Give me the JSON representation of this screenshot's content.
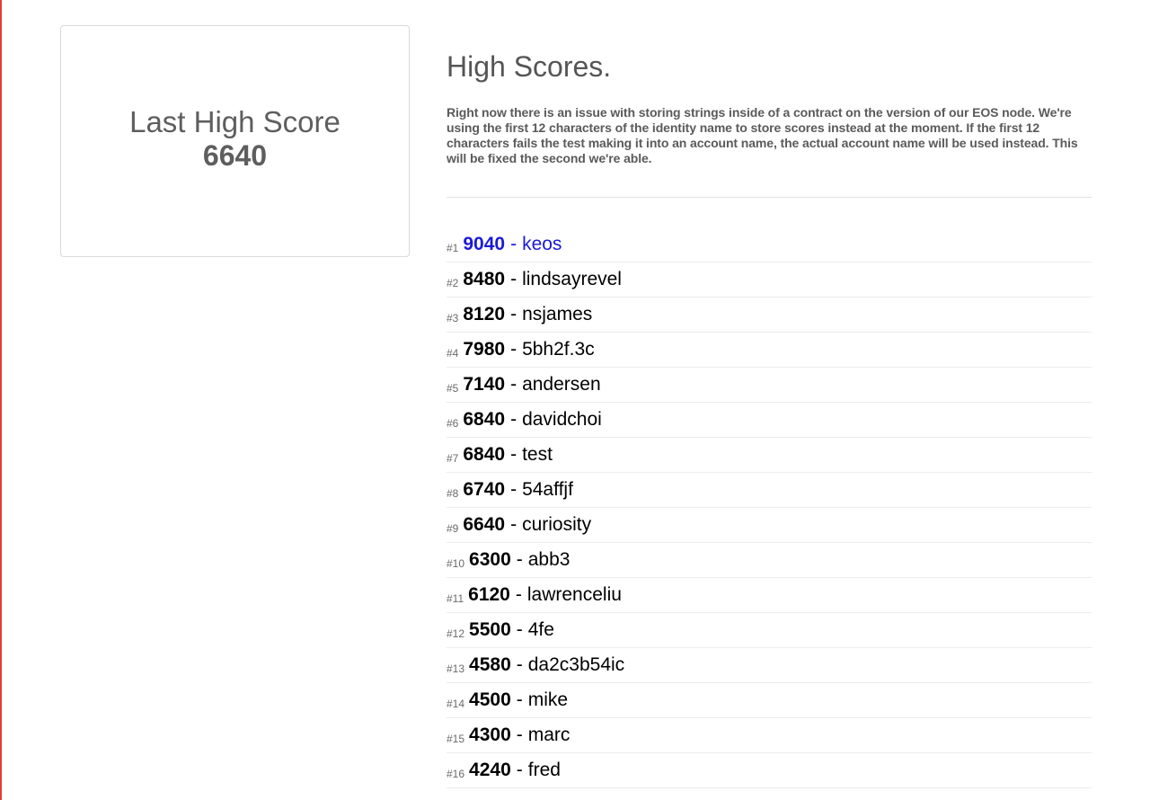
{
  "last_high_score": {
    "label": "Last High Score",
    "value": "6640"
  },
  "main": {
    "title": "High Scores.",
    "notice": "Right now there is an issue with storing strings inside of a contract on the version of our EOS node. We're using the first 12 characters of the identity name to store scores instead at the moment. If the first 12 characters fails the test making it into an account name, the actual account name will be used instead. This will be fixed the second we're able."
  },
  "separator": "-",
  "scores": [
    {
      "rank": "#1",
      "score": "9040",
      "name": "keos"
    },
    {
      "rank": "#2",
      "score": "8480",
      "name": "lindsayrevel"
    },
    {
      "rank": "#3",
      "score": "8120",
      "name": "nsjames"
    },
    {
      "rank": "#4",
      "score": "7980",
      "name": "5bh2f.3c"
    },
    {
      "rank": "#5",
      "score": "7140",
      "name": "andersen"
    },
    {
      "rank": "#6",
      "score": "6840",
      "name": "davidchoi"
    },
    {
      "rank": "#7",
      "score": "6840",
      "name": "test"
    },
    {
      "rank": "#8",
      "score": "6740",
      "name": "54affjf"
    },
    {
      "rank": "#9",
      "score": "6640",
      "name": "curiosity"
    },
    {
      "rank": "#10",
      "score": "6300",
      "name": "abb3"
    },
    {
      "rank": "#11",
      "score": "6120",
      "name": "lawrenceliu"
    },
    {
      "rank": "#12",
      "score": "5500",
      "name": "4fe"
    },
    {
      "rank": "#13",
      "score": "4580",
      "name": "da2c3b54ic"
    },
    {
      "rank": "#14",
      "score": "4500",
      "name": "mike"
    },
    {
      "rank": "#15",
      "score": "4300",
      "name": "marc"
    },
    {
      "rank": "#16",
      "score": "4240",
      "name": "fred"
    }
  ],
  "colors": {
    "highlight": "#1a1ad6",
    "edge": "#e23d3d"
  }
}
